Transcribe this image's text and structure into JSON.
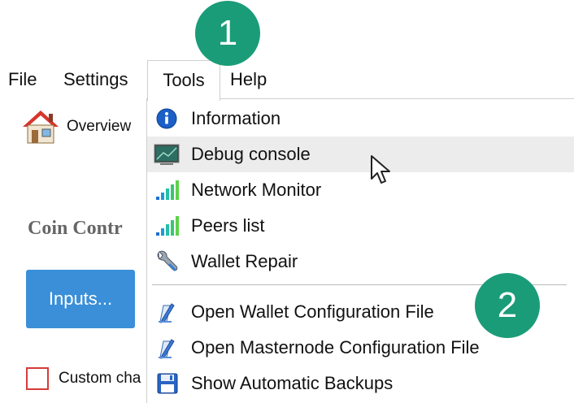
{
  "menubar": {
    "file": "File",
    "settings": "Settings",
    "tools": "Tools",
    "help": "Help"
  },
  "sidebar": {
    "overview_label": "Overview"
  },
  "coin_control": {
    "title": "Coin Contr",
    "inputs_button": "Inputs...",
    "custom_change_label": "Custom cha"
  },
  "tools_menu": {
    "items": [
      {
        "label": "Information",
        "icon": "info-icon"
      },
      {
        "label": "Debug console",
        "icon": "console-icon"
      },
      {
        "label": "Network Monitor",
        "icon": "signal-bars-icon"
      },
      {
        "label": "Peers list",
        "icon": "signal-bars-icon"
      },
      {
        "label": "Wallet Repair",
        "icon": "wrench-icon"
      },
      {
        "label": "Open Wallet Configuration File",
        "icon": "edit-document-icon"
      },
      {
        "label": "Open Masternode Configuration File",
        "icon": "edit-document-icon"
      },
      {
        "label": "Show Automatic Backups",
        "icon": "floppy-disk-icon"
      }
    ]
  },
  "annotations": {
    "step1": "1",
    "step2": "2"
  },
  "colors": {
    "accent_button": "#3a8fd8",
    "badge": "#1a9c79",
    "checkbox_border": "#d63b3b",
    "highlight": "#ececec"
  }
}
